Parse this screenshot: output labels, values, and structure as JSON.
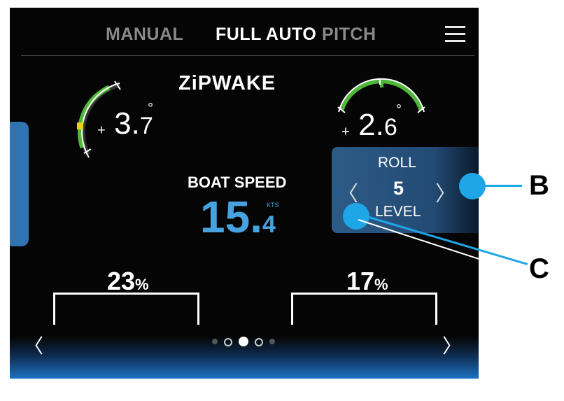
{
  "header": {
    "tabs": [
      {
        "label": "MANUAL",
        "active": false
      },
      {
        "label": "FULL AUTO",
        "active": true
      },
      {
        "label": "PITCH",
        "active": false
      }
    ]
  },
  "logo": {
    "text": "ZiPWAKE"
  },
  "pitch_gauge": {
    "sign": "+",
    "value_int": "3.",
    "value_dec": "7",
    "degree_symbol": "°"
  },
  "roll_gauge": {
    "sign": "+",
    "value_int": "2.",
    "value_dec": "6",
    "degree_symbol": "°"
  },
  "boat_speed": {
    "label": "BOAT SPEED",
    "value_int": "15",
    "dot": ".",
    "value_dec": "4",
    "unit": "KTS"
  },
  "roll_control": {
    "title": "ROLL",
    "value": "5",
    "level_label": "LEVEL",
    "prev_chevron": "〈",
    "next_chevron": "〉"
  },
  "interceptors": [
    {
      "value": "23",
      "unit": "%"
    },
    {
      "value": "17",
      "unit": "%"
    }
  ],
  "pager": {
    "prev": "〈",
    "next": "〉",
    "active_index": 2,
    "count": 5
  },
  "callouts": [
    {
      "label": "B"
    },
    {
      "label": "C"
    }
  ],
  "colors": {
    "accent_blue": "#46a3e0",
    "panel_blue": "#2d5b87",
    "callout": "#1fa6e6",
    "gauge_green": "#4fb83a",
    "gauge_marker": "#e8d21a"
  }
}
